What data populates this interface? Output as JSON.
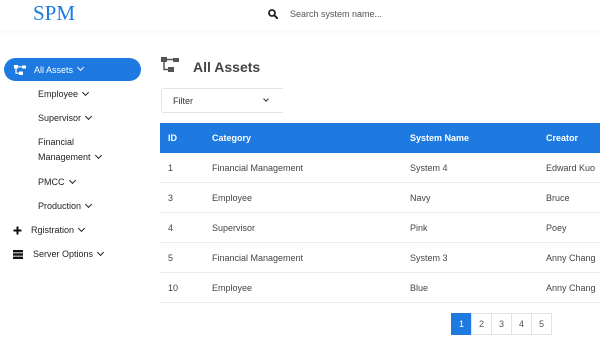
{
  "app": {
    "logo": "SPM"
  },
  "search": {
    "placeholder": "Search system name..."
  },
  "sidebar": {
    "active": "All Assets",
    "items": [
      "Employee",
      "Supervisor",
      "Financial",
      "Management",
      "PMCC",
      "Production"
    ],
    "registration": "Rgistration",
    "server_options": "Server Options"
  },
  "page": {
    "title": "All Assets"
  },
  "filter": {
    "label": "Filter"
  },
  "table": {
    "headers": [
      "ID",
      "Category",
      "System Name",
      "Creator"
    ],
    "rows": [
      [
        "1",
        "Financial Management",
        "System 4",
        "Edward Kuo"
      ],
      [
        "3",
        "Employee",
        "Navy",
        "Bruce"
      ],
      [
        "4",
        "Supervisor",
        "Pink",
        "Poey"
      ],
      [
        "5",
        "Financial Management",
        "System 3",
        "Anny Chang"
      ],
      [
        "10",
        "Employee",
        "Blue",
        "Anny Chang"
      ]
    ]
  },
  "pagination": {
    "pages": [
      "1",
      "2",
      "3",
      "4",
      "5"
    ],
    "current": "1"
  },
  "colors": {
    "accent": "#1e7ae0"
  }
}
